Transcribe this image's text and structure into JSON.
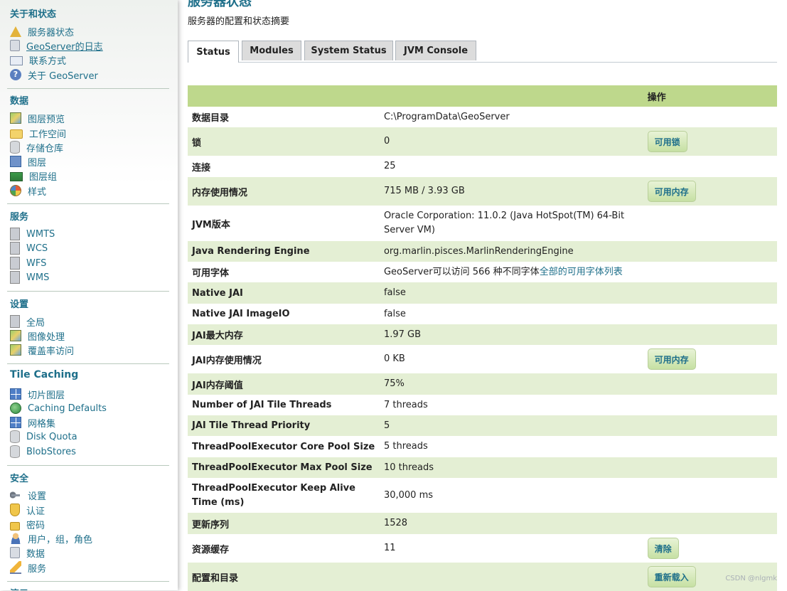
{
  "sidebar": {
    "sections": [
      {
        "title": "关于和状态",
        "items": [
          {
            "label": "服务器状态",
            "icon": "server-status-icon"
          },
          {
            "label": "GeoServer的日志",
            "icon": "log-icon"
          },
          {
            "label": "联系方式",
            "icon": "contact-card-icon"
          },
          {
            "label": "关于 GeoServer",
            "icon": "help-icon"
          }
        ]
      },
      {
        "title": "数据",
        "items": [
          {
            "label": "图层预览",
            "icon": "map-preview-icon"
          },
          {
            "label": "工作空间",
            "icon": "folder-icon"
          },
          {
            "label": "存储仓库",
            "icon": "database-icon"
          },
          {
            "label": "图层",
            "icon": "layer-icon"
          },
          {
            "label": "图层组",
            "icon": "layer-group-icon"
          },
          {
            "label": "样式",
            "icon": "palette-icon"
          }
        ]
      },
      {
        "title": "服务",
        "items": [
          {
            "label": "WMTS",
            "icon": "service-icon"
          },
          {
            "label": "WCS",
            "icon": "service-icon"
          },
          {
            "label": "WFS",
            "icon": "service-icon"
          },
          {
            "label": "WMS",
            "icon": "service-icon"
          }
        ]
      },
      {
        "title": "设置",
        "items": [
          {
            "label": "全局",
            "icon": "server-icon"
          },
          {
            "label": "图像处理",
            "icon": "image-processing-icon"
          },
          {
            "label": "覆盖率访问",
            "icon": "coverage-icon"
          }
        ]
      },
      {
        "title": "Tile Caching",
        "items": [
          {
            "label": "切片图层",
            "icon": "tile-grid-icon"
          },
          {
            "label": "Caching Defaults",
            "icon": "globe-icon"
          },
          {
            "label": "网格集",
            "icon": "tile-grid-icon"
          },
          {
            "label": "Disk Quota",
            "icon": "database-icon"
          },
          {
            "label": "BlobStores",
            "icon": "database-icon"
          }
        ]
      },
      {
        "title": "安全",
        "items": [
          {
            "label": "设置",
            "icon": "key-icon"
          },
          {
            "label": "认证",
            "icon": "shield-icon"
          },
          {
            "label": "密码",
            "icon": "lock-icon"
          },
          {
            "label": "用户，组，角色",
            "icon": "user-icon"
          },
          {
            "label": "数据",
            "icon": "data-security-icon"
          },
          {
            "label": "服务",
            "icon": "service-security-icon"
          }
        ]
      },
      {
        "title": "演示",
        "items": []
      }
    ]
  },
  "main": {
    "title": "服务器状态",
    "description": "服务器的配置和状态摘要",
    "tabs": [
      {
        "label": "Status"
      },
      {
        "label": "Modules"
      },
      {
        "label": "System Status"
      },
      {
        "label": "JVM Console"
      }
    ],
    "table": {
      "action_header": "操作",
      "rows": [
        {
          "key": "数据目录",
          "value": "C:\\ProgramData\\GeoServer",
          "action": ""
        },
        {
          "key": "锁",
          "value": "0",
          "action": "可用锁"
        },
        {
          "key": "连接",
          "value": "25",
          "action": ""
        },
        {
          "key": "内存使用情况",
          "value": "715 MB / 3.93 GB",
          "action": "可用内存"
        },
        {
          "key": "JVM版本",
          "value": "Oracle Corporation: 11.0.2 (Java HotSpot(TM) 64-Bit Server VM)",
          "action": ""
        },
        {
          "key": "Java Rendering Engine",
          "value": "org.marlin.pisces.MarlinRenderingEngine",
          "action": ""
        },
        {
          "key": "可用字体",
          "value": "GeoServer可以访问 566 种不同字体",
          "link": "全部的可用字体列表",
          "action": ""
        },
        {
          "key": "Native JAI",
          "value": "false",
          "action": ""
        },
        {
          "key": "Native JAI ImageIO",
          "value": "false",
          "action": ""
        },
        {
          "key": "JAI最大内存",
          "value": "1.97 GB",
          "action": ""
        },
        {
          "key": "JAI内存使用情况",
          "value": "0 KB",
          "action": "可用内存"
        },
        {
          "key": "JAI内存阈值",
          "value": "75%",
          "action": ""
        },
        {
          "key": "Number of JAI Tile Threads",
          "value": "7 threads",
          "action": ""
        },
        {
          "key": "JAI Tile Thread Priority",
          "value": "5",
          "action": ""
        },
        {
          "key": "ThreadPoolExecutor Core Pool Size",
          "value": "5 threads",
          "action": ""
        },
        {
          "key": "ThreadPoolExecutor Max Pool Size",
          "value": "10 threads",
          "action": ""
        },
        {
          "key": "ThreadPoolExecutor Keep Alive Time (ms)",
          "value": "30,000 ms",
          "action": ""
        },
        {
          "key": "更新序列",
          "value": "1528",
          "action": ""
        },
        {
          "key": "资源缓存",
          "value": "11",
          "action": "清除"
        },
        {
          "key": "配置和目录",
          "value": "",
          "action": "重新载入"
        }
      ]
    }
  },
  "watermark": "CSDN @nlgmk",
  "colors": {
    "accent": "#1e6f8a",
    "header_green": "#bed88c",
    "row_green": "#e4efd4"
  }
}
